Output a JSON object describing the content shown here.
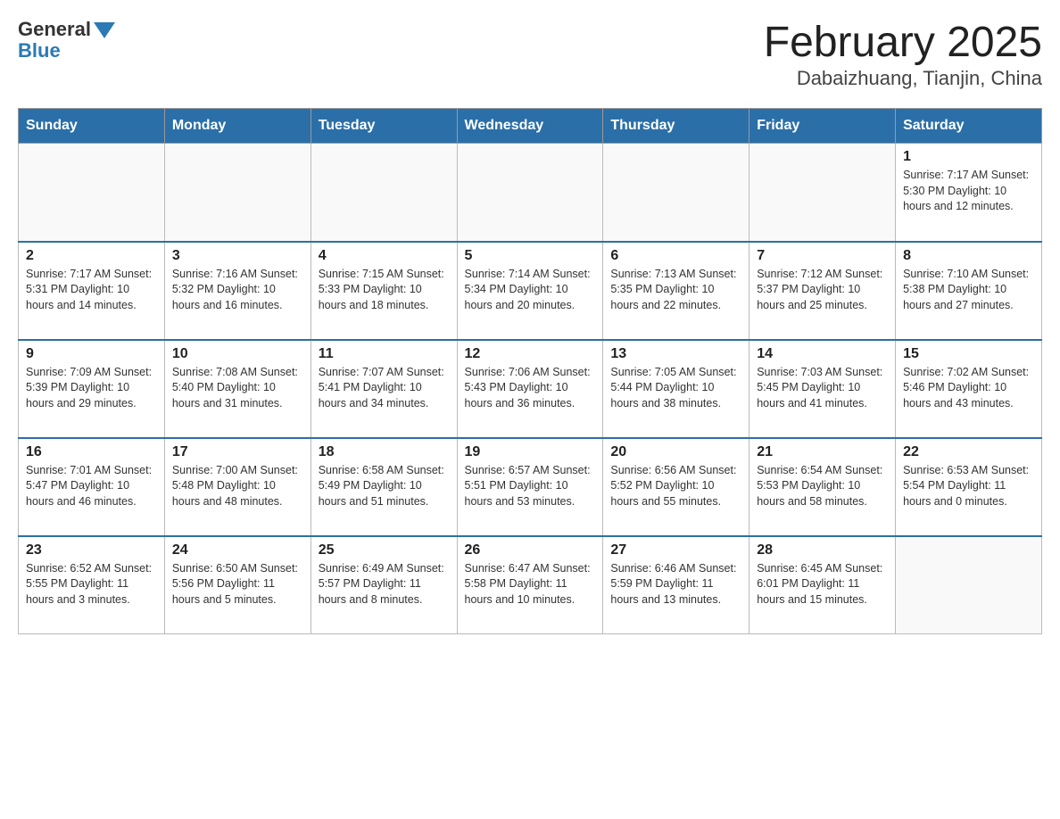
{
  "header": {
    "logo_general": "General",
    "logo_blue": "Blue",
    "month_title": "February 2025",
    "location": "Dabaizhuang, Tianjin, China"
  },
  "weekdays": [
    "Sunday",
    "Monday",
    "Tuesday",
    "Wednesday",
    "Thursday",
    "Friday",
    "Saturday"
  ],
  "weeks": [
    {
      "days": [
        {
          "num": "",
          "info": ""
        },
        {
          "num": "",
          "info": ""
        },
        {
          "num": "",
          "info": ""
        },
        {
          "num": "",
          "info": ""
        },
        {
          "num": "",
          "info": ""
        },
        {
          "num": "",
          "info": ""
        },
        {
          "num": "1",
          "info": "Sunrise: 7:17 AM\nSunset: 5:30 PM\nDaylight: 10 hours and 12 minutes."
        }
      ]
    },
    {
      "days": [
        {
          "num": "2",
          "info": "Sunrise: 7:17 AM\nSunset: 5:31 PM\nDaylight: 10 hours and 14 minutes."
        },
        {
          "num": "3",
          "info": "Sunrise: 7:16 AM\nSunset: 5:32 PM\nDaylight: 10 hours and 16 minutes."
        },
        {
          "num": "4",
          "info": "Sunrise: 7:15 AM\nSunset: 5:33 PM\nDaylight: 10 hours and 18 minutes."
        },
        {
          "num": "5",
          "info": "Sunrise: 7:14 AM\nSunset: 5:34 PM\nDaylight: 10 hours and 20 minutes."
        },
        {
          "num": "6",
          "info": "Sunrise: 7:13 AM\nSunset: 5:35 PM\nDaylight: 10 hours and 22 minutes."
        },
        {
          "num": "7",
          "info": "Sunrise: 7:12 AM\nSunset: 5:37 PM\nDaylight: 10 hours and 25 minutes."
        },
        {
          "num": "8",
          "info": "Sunrise: 7:10 AM\nSunset: 5:38 PM\nDaylight: 10 hours and 27 minutes."
        }
      ]
    },
    {
      "days": [
        {
          "num": "9",
          "info": "Sunrise: 7:09 AM\nSunset: 5:39 PM\nDaylight: 10 hours and 29 minutes."
        },
        {
          "num": "10",
          "info": "Sunrise: 7:08 AM\nSunset: 5:40 PM\nDaylight: 10 hours and 31 minutes."
        },
        {
          "num": "11",
          "info": "Sunrise: 7:07 AM\nSunset: 5:41 PM\nDaylight: 10 hours and 34 minutes."
        },
        {
          "num": "12",
          "info": "Sunrise: 7:06 AM\nSunset: 5:43 PM\nDaylight: 10 hours and 36 minutes."
        },
        {
          "num": "13",
          "info": "Sunrise: 7:05 AM\nSunset: 5:44 PM\nDaylight: 10 hours and 38 minutes."
        },
        {
          "num": "14",
          "info": "Sunrise: 7:03 AM\nSunset: 5:45 PM\nDaylight: 10 hours and 41 minutes."
        },
        {
          "num": "15",
          "info": "Sunrise: 7:02 AM\nSunset: 5:46 PM\nDaylight: 10 hours and 43 minutes."
        }
      ]
    },
    {
      "days": [
        {
          "num": "16",
          "info": "Sunrise: 7:01 AM\nSunset: 5:47 PM\nDaylight: 10 hours and 46 minutes."
        },
        {
          "num": "17",
          "info": "Sunrise: 7:00 AM\nSunset: 5:48 PM\nDaylight: 10 hours and 48 minutes."
        },
        {
          "num": "18",
          "info": "Sunrise: 6:58 AM\nSunset: 5:49 PM\nDaylight: 10 hours and 51 minutes."
        },
        {
          "num": "19",
          "info": "Sunrise: 6:57 AM\nSunset: 5:51 PM\nDaylight: 10 hours and 53 minutes."
        },
        {
          "num": "20",
          "info": "Sunrise: 6:56 AM\nSunset: 5:52 PM\nDaylight: 10 hours and 55 minutes."
        },
        {
          "num": "21",
          "info": "Sunrise: 6:54 AM\nSunset: 5:53 PM\nDaylight: 10 hours and 58 minutes."
        },
        {
          "num": "22",
          "info": "Sunrise: 6:53 AM\nSunset: 5:54 PM\nDaylight: 11 hours and 0 minutes."
        }
      ]
    },
    {
      "days": [
        {
          "num": "23",
          "info": "Sunrise: 6:52 AM\nSunset: 5:55 PM\nDaylight: 11 hours and 3 minutes."
        },
        {
          "num": "24",
          "info": "Sunrise: 6:50 AM\nSunset: 5:56 PM\nDaylight: 11 hours and 5 minutes."
        },
        {
          "num": "25",
          "info": "Sunrise: 6:49 AM\nSunset: 5:57 PM\nDaylight: 11 hours and 8 minutes."
        },
        {
          "num": "26",
          "info": "Sunrise: 6:47 AM\nSunset: 5:58 PM\nDaylight: 11 hours and 10 minutes."
        },
        {
          "num": "27",
          "info": "Sunrise: 6:46 AM\nSunset: 5:59 PM\nDaylight: 11 hours and 13 minutes."
        },
        {
          "num": "28",
          "info": "Sunrise: 6:45 AM\nSunset: 6:01 PM\nDaylight: 11 hours and 15 minutes."
        },
        {
          "num": "",
          "info": ""
        }
      ]
    }
  ]
}
